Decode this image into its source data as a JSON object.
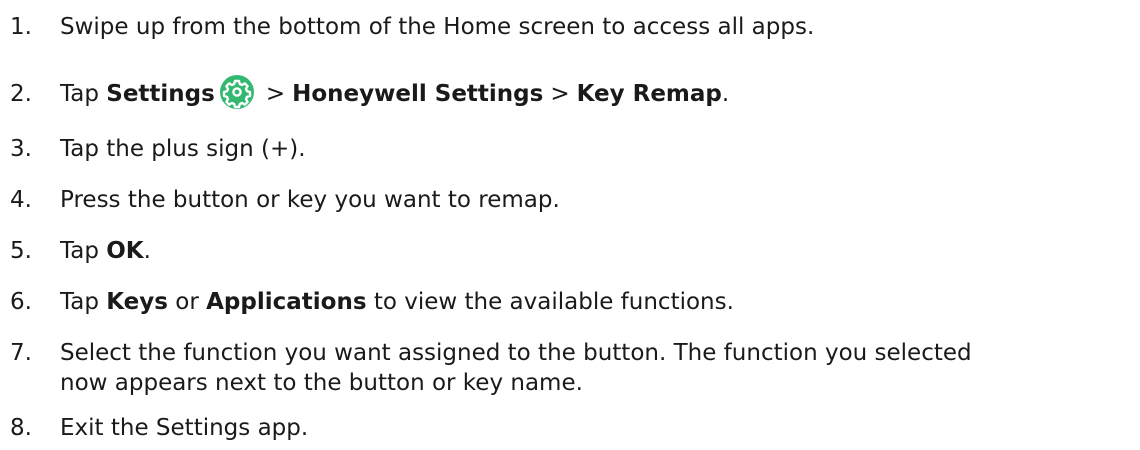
{
  "steps": [
    {
      "num": "1.",
      "text": "Swipe up from the bottom of the Home screen to access all apps."
    },
    {
      "num": "2.",
      "pre": "Tap ",
      "b1": "Settings",
      "sep1": ">",
      "b2": "Honeywell Settings",
      "sep2": ">",
      "b3": "Key Remap",
      "post": ".",
      "icon": "settings-gear-icon",
      "icon_color": "#33b871"
    },
    {
      "num": "3.",
      "text": "Tap the plus sign (+)."
    },
    {
      "num": "4.",
      "text": "Press the button or key you want to remap."
    },
    {
      "num": "5.",
      "pre": "Tap ",
      "b1": "OK",
      "post": "."
    },
    {
      "num": "6.",
      "pre": "Tap ",
      "b1": "Keys",
      "mid": " or ",
      "b2": "Applications",
      "post": " to view the available functions."
    },
    {
      "num": "7.",
      "line1": "Select the function you want assigned to the button. The function you selected",
      "line2": "now appears next to the button or key name."
    },
    {
      "num": "8.",
      "text": "Exit the Settings app."
    }
  ]
}
